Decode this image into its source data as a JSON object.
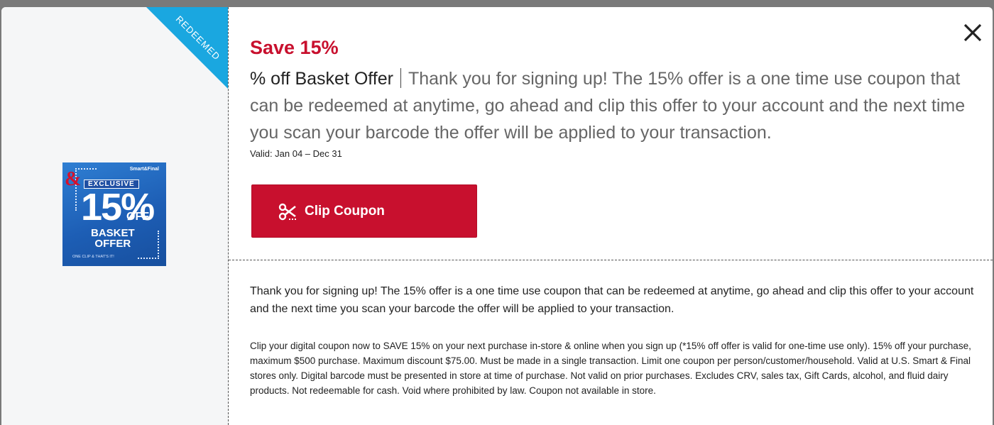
{
  "ribbon": {
    "label": "REDEEMED",
    "color": "#1aa7e0"
  },
  "coupon_image": {
    "brand": "Smart&Final",
    "exclusive": "EXCLUSIVE",
    "percent": "15%",
    "off": "OFF",
    "line1": "BASKET",
    "line2": "OFFER",
    "tagline": "ONE CLIP & THAT'S IT!"
  },
  "offer": {
    "headline": "Save 15%",
    "name": "% off Basket Offer",
    "summary": "Thank you for signing up! The 15% offer is a one time use coupon that can be redeemed at anytime, go ahead and clip this offer to your account and the next time you scan your barcode the offer will be applied to your transaction.",
    "valid": "Valid: Jan 04 – Dec 31"
  },
  "clip_button": {
    "label": "Clip Coupon",
    "icon": "scissors-icon",
    "color": "#c8102e"
  },
  "close_button": {
    "icon": "close-icon"
  },
  "details": {
    "description": "Thank you for signing up! The 15% offer is a one time use coupon that can be redeemed at anytime, go ahead and clip this offer to your account and the next time you scan your barcode the offer will be applied to your transaction.",
    "fine_print": "Clip your digital coupon now to SAVE 15% on your next purchase in-store & online when you sign up (*15% off offer is valid for one-time use only). 15% off your purchase, maximum $500 purchase. Maximum discount $75.00. Must be made in a single transaction. Limit one coupon per person/customer/household. Valid at U.S. Smart & Final stores only. Digital barcode must be presented in store at time of purchase. Not valid on prior purchases. Excludes CRV, sales tax, Gift Cards, alcohol, and fluid dairy products. Not redeemable for cash. Void where prohibited by law. Coupon not available in store."
  }
}
